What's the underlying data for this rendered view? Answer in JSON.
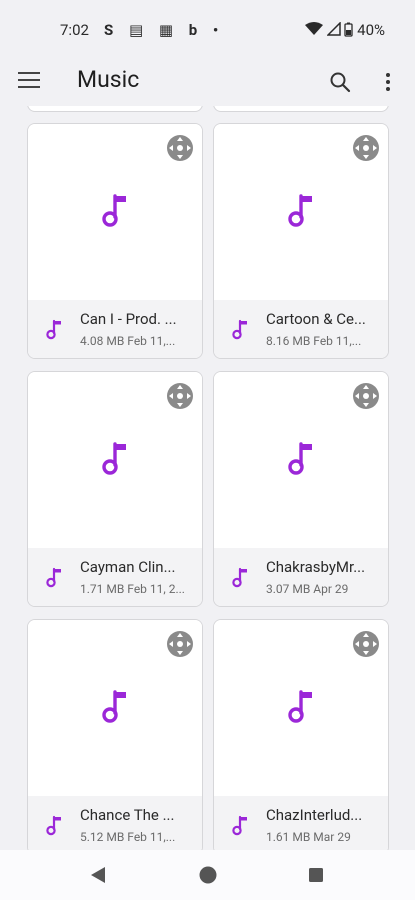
{
  "status": {
    "time": "7:02",
    "notifications": "S ▤ ▦ b •",
    "battery": "40%"
  },
  "header": {
    "title": "Music"
  },
  "items": [
    {
      "name": "Can I - Prod. ...",
      "meta": "4.08 MB Feb 11,..."
    },
    {
      "name": "Cartoon & Ce...",
      "meta": "8.16 MB Feb 11,..."
    },
    {
      "name": "Cayman Clin...",
      "meta": "1.71 MB Feb 11, 2..."
    },
    {
      "name": "ChakrasbyMr...",
      "meta": "3.07 MB Apr 29"
    },
    {
      "name": "Chance The ...",
      "meta": "5.12 MB Feb 11,..."
    },
    {
      "name": "ChazInterlud...",
      "meta": "1.61 MB Mar 29"
    }
  ],
  "colors": {
    "accent": "#9b27d8",
    "check_circle": "#8a8a8a"
  }
}
